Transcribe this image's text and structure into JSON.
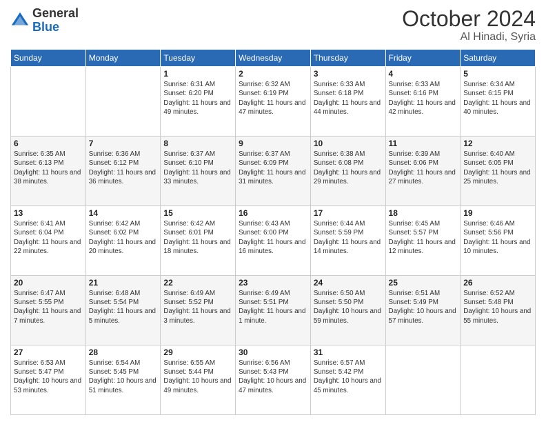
{
  "header": {
    "logo_general": "General",
    "logo_blue": "Blue",
    "month": "October 2024",
    "location": "Al Hinadi, Syria"
  },
  "days_of_week": [
    "Sunday",
    "Monday",
    "Tuesday",
    "Wednesday",
    "Thursday",
    "Friday",
    "Saturday"
  ],
  "weeks": [
    [
      {
        "day": "",
        "info": ""
      },
      {
        "day": "",
        "info": ""
      },
      {
        "day": "1",
        "info": "Sunrise: 6:31 AM\nSunset: 6:20 PM\nDaylight: 11 hours and 49 minutes."
      },
      {
        "day": "2",
        "info": "Sunrise: 6:32 AM\nSunset: 6:19 PM\nDaylight: 11 hours and 47 minutes."
      },
      {
        "day": "3",
        "info": "Sunrise: 6:33 AM\nSunset: 6:18 PM\nDaylight: 11 hours and 44 minutes."
      },
      {
        "day": "4",
        "info": "Sunrise: 6:33 AM\nSunset: 6:16 PM\nDaylight: 11 hours and 42 minutes."
      },
      {
        "day": "5",
        "info": "Sunrise: 6:34 AM\nSunset: 6:15 PM\nDaylight: 11 hours and 40 minutes."
      }
    ],
    [
      {
        "day": "6",
        "info": "Sunrise: 6:35 AM\nSunset: 6:13 PM\nDaylight: 11 hours and 38 minutes."
      },
      {
        "day": "7",
        "info": "Sunrise: 6:36 AM\nSunset: 6:12 PM\nDaylight: 11 hours and 36 minutes."
      },
      {
        "day": "8",
        "info": "Sunrise: 6:37 AM\nSunset: 6:10 PM\nDaylight: 11 hours and 33 minutes."
      },
      {
        "day": "9",
        "info": "Sunrise: 6:37 AM\nSunset: 6:09 PM\nDaylight: 11 hours and 31 minutes."
      },
      {
        "day": "10",
        "info": "Sunrise: 6:38 AM\nSunset: 6:08 PM\nDaylight: 11 hours and 29 minutes."
      },
      {
        "day": "11",
        "info": "Sunrise: 6:39 AM\nSunset: 6:06 PM\nDaylight: 11 hours and 27 minutes."
      },
      {
        "day": "12",
        "info": "Sunrise: 6:40 AM\nSunset: 6:05 PM\nDaylight: 11 hours and 25 minutes."
      }
    ],
    [
      {
        "day": "13",
        "info": "Sunrise: 6:41 AM\nSunset: 6:04 PM\nDaylight: 11 hours and 22 minutes."
      },
      {
        "day": "14",
        "info": "Sunrise: 6:42 AM\nSunset: 6:02 PM\nDaylight: 11 hours and 20 minutes."
      },
      {
        "day": "15",
        "info": "Sunrise: 6:42 AM\nSunset: 6:01 PM\nDaylight: 11 hours and 18 minutes."
      },
      {
        "day": "16",
        "info": "Sunrise: 6:43 AM\nSunset: 6:00 PM\nDaylight: 11 hours and 16 minutes."
      },
      {
        "day": "17",
        "info": "Sunrise: 6:44 AM\nSunset: 5:59 PM\nDaylight: 11 hours and 14 minutes."
      },
      {
        "day": "18",
        "info": "Sunrise: 6:45 AM\nSunset: 5:57 PM\nDaylight: 11 hours and 12 minutes."
      },
      {
        "day": "19",
        "info": "Sunrise: 6:46 AM\nSunset: 5:56 PM\nDaylight: 11 hours and 10 minutes."
      }
    ],
    [
      {
        "day": "20",
        "info": "Sunrise: 6:47 AM\nSunset: 5:55 PM\nDaylight: 11 hours and 7 minutes."
      },
      {
        "day": "21",
        "info": "Sunrise: 6:48 AM\nSunset: 5:54 PM\nDaylight: 11 hours and 5 minutes."
      },
      {
        "day": "22",
        "info": "Sunrise: 6:49 AM\nSunset: 5:52 PM\nDaylight: 11 hours and 3 minutes."
      },
      {
        "day": "23",
        "info": "Sunrise: 6:49 AM\nSunset: 5:51 PM\nDaylight: 11 hours and 1 minute."
      },
      {
        "day": "24",
        "info": "Sunrise: 6:50 AM\nSunset: 5:50 PM\nDaylight: 10 hours and 59 minutes."
      },
      {
        "day": "25",
        "info": "Sunrise: 6:51 AM\nSunset: 5:49 PM\nDaylight: 10 hours and 57 minutes."
      },
      {
        "day": "26",
        "info": "Sunrise: 6:52 AM\nSunset: 5:48 PM\nDaylight: 10 hours and 55 minutes."
      }
    ],
    [
      {
        "day": "27",
        "info": "Sunrise: 6:53 AM\nSunset: 5:47 PM\nDaylight: 10 hours and 53 minutes."
      },
      {
        "day": "28",
        "info": "Sunrise: 6:54 AM\nSunset: 5:45 PM\nDaylight: 10 hours and 51 minutes."
      },
      {
        "day": "29",
        "info": "Sunrise: 6:55 AM\nSunset: 5:44 PM\nDaylight: 10 hours and 49 minutes."
      },
      {
        "day": "30",
        "info": "Sunrise: 6:56 AM\nSunset: 5:43 PM\nDaylight: 10 hours and 47 minutes."
      },
      {
        "day": "31",
        "info": "Sunrise: 6:57 AM\nSunset: 5:42 PM\nDaylight: 10 hours and 45 minutes."
      },
      {
        "day": "",
        "info": ""
      },
      {
        "day": "",
        "info": ""
      }
    ]
  ]
}
